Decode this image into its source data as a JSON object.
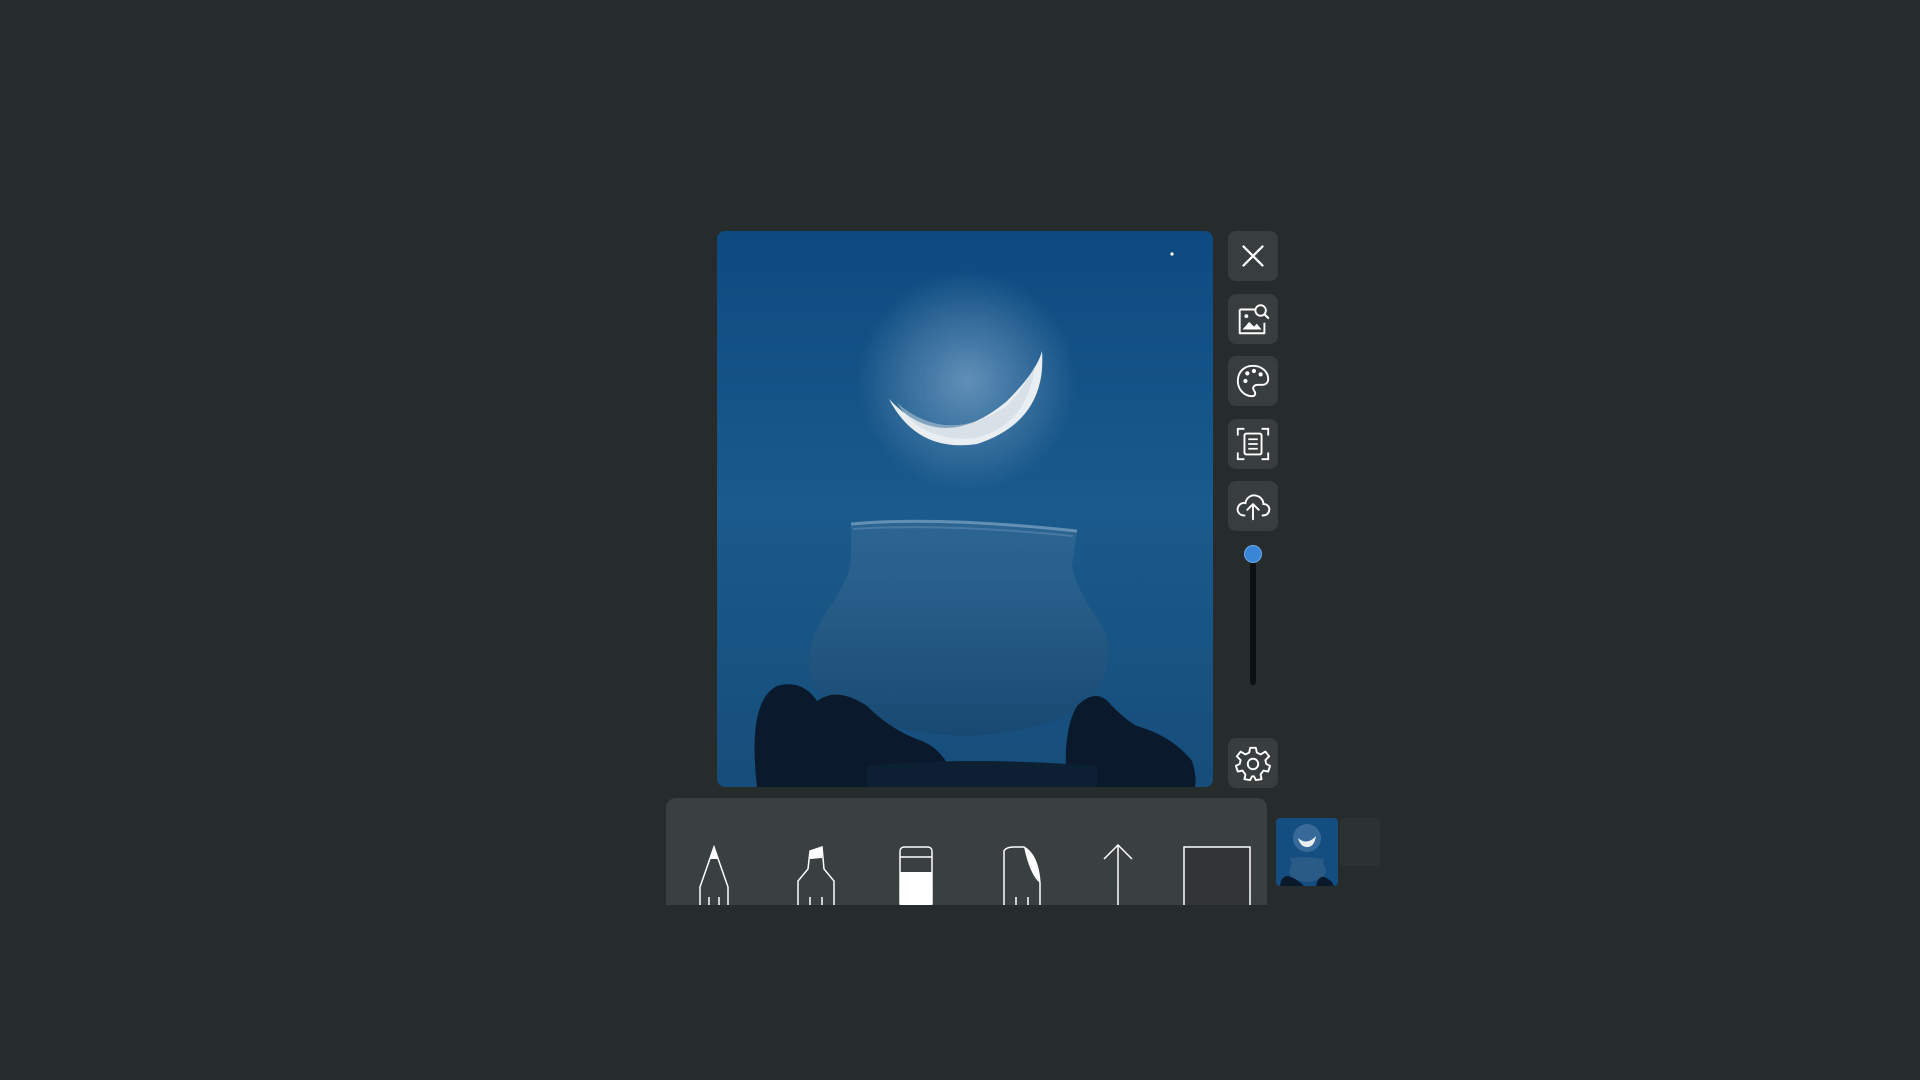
{
  "colors": {
    "background": "#262b2c",
    "toolbar_button": "#383d3e",
    "tray": "#3a3f40",
    "slider_thumb": "#3a86d6",
    "sky": "#0f4a7e"
  },
  "photo": {
    "subject": "crescent-moon-over-glass-jar"
  },
  "toolbar": {
    "buttons": [
      {
        "name": "close-icon"
      },
      {
        "name": "image-search-icon"
      },
      {
        "name": "palette-icon"
      },
      {
        "name": "text-scan-icon"
      },
      {
        "name": "cloud-upload-icon"
      },
      {
        "name": "settings-gear-icon"
      }
    ]
  },
  "size_slider": {
    "level": 1.0
  },
  "tray": {
    "tools": [
      {
        "name": "pencil-icon"
      },
      {
        "name": "marker-icon"
      },
      {
        "name": "eraser-icon"
      },
      {
        "name": "lasso-icon"
      },
      {
        "name": "ruler-arrow-icon"
      },
      {
        "name": "shape-square-icon"
      }
    ]
  }
}
